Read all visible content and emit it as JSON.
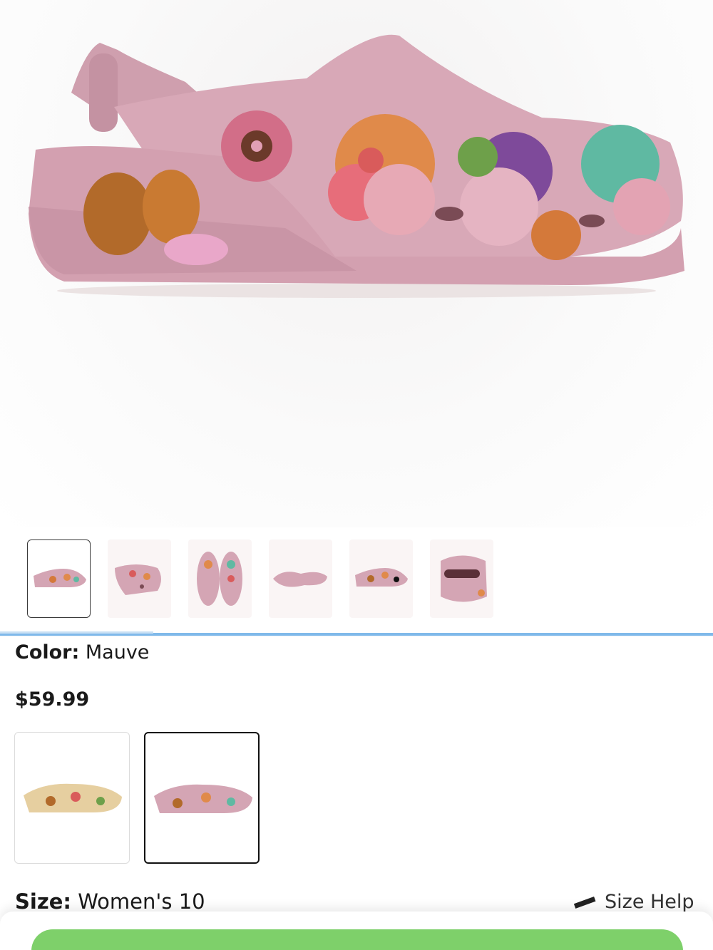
{
  "product": {
    "image_alt": "Mauve clog with colorful studded flower charms",
    "shoe_color": "#d4a5b4"
  },
  "thumbnails": [
    {
      "name": "side-view",
      "selected": true
    },
    {
      "name": "angle-view",
      "selected": false
    },
    {
      "name": "top-view",
      "selected": false
    },
    {
      "name": "sole-view",
      "selected": false
    },
    {
      "name": "side-view-2",
      "selected": false
    },
    {
      "name": "back-view",
      "selected": false
    }
  ],
  "color": {
    "label": "Color:",
    "value": " Mauve"
  },
  "price": "$59.99",
  "swatches": [
    {
      "name": "tan-floral",
      "selected": false
    },
    {
      "name": "mauve-floral",
      "selected": true
    }
  ],
  "size": {
    "label": "Size:",
    "value": " Women's 10"
  },
  "size_help": {
    "label": "Size Help",
    "icon": "ruler-icon"
  },
  "colors": {
    "accent": "#7ed06a",
    "divider": "#7fb9ea",
    "mauve": "#d4a5b4"
  }
}
